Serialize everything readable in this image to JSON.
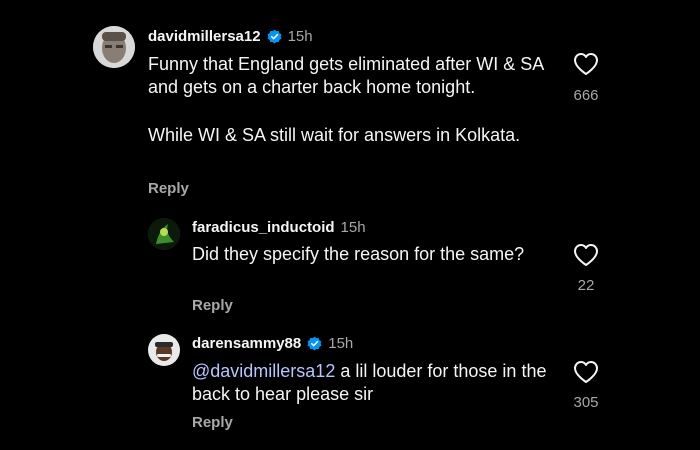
{
  "comments": [
    {
      "username": "davidmillersa12",
      "verified": true,
      "time": "15h",
      "paragraphs": [
        "Funny that England gets eliminated after WI & SA and gets on a charter back home tonight.",
        "While WI & SA still wait for answers in Kolkata."
      ],
      "reply_label": "Reply",
      "likes": "666"
    },
    {
      "username": "faradicus_inductoid",
      "verified": false,
      "time": "15h",
      "text": "Did they specify the reason for the same?",
      "reply_label": "Reply",
      "likes": "22"
    },
    {
      "username": "darensammy88",
      "verified": true,
      "time": "15h",
      "mention": "@davidmillersa12",
      "text": " a lil louder for those in the back to hear please sir",
      "reply_label": "Reply",
      "likes": "305"
    }
  ],
  "icons": {
    "like": "heart-outline-icon",
    "verified": "verified-badge-icon"
  },
  "colors": {
    "background": "#000000",
    "mention": "#b7c5ff",
    "verified": "#0095f6",
    "secondary_text": "#a8a8a8"
  }
}
